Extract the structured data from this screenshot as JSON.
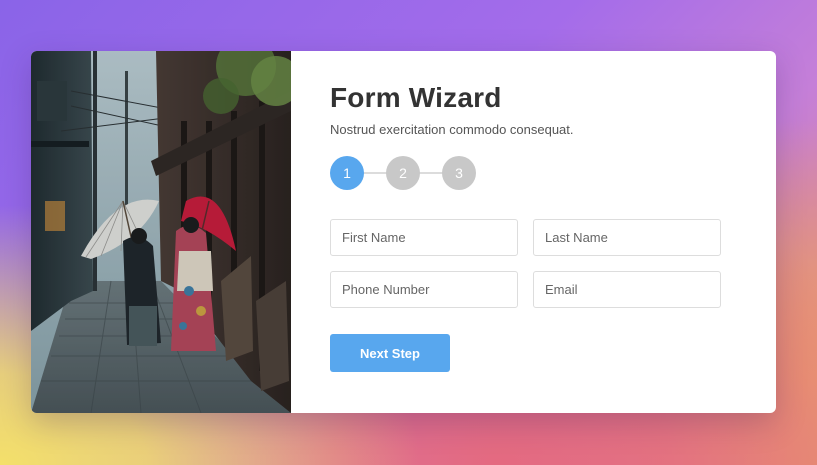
{
  "colors": {
    "accent": "#58a7ee",
    "step_inactive": "#c8c8c8",
    "title": "#333333",
    "card_bg": "#ffffff"
  },
  "image": {
    "description_icon": "street-photo"
  },
  "form": {
    "title": "Form Wizard",
    "subtitle": "Nostrud exercitation commodo consequat.",
    "steps": [
      {
        "label": "1",
        "active": true
      },
      {
        "label": "2",
        "active": false
      },
      {
        "label": "3",
        "active": false
      }
    ],
    "fields": {
      "first_name": {
        "placeholder": "First Name",
        "value": ""
      },
      "last_name": {
        "placeholder": "Last Name",
        "value": ""
      },
      "phone": {
        "placeholder": "Phone Number",
        "value": ""
      },
      "email": {
        "placeholder": "Email",
        "value": ""
      }
    },
    "next_label": "Next Step"
  }
}
